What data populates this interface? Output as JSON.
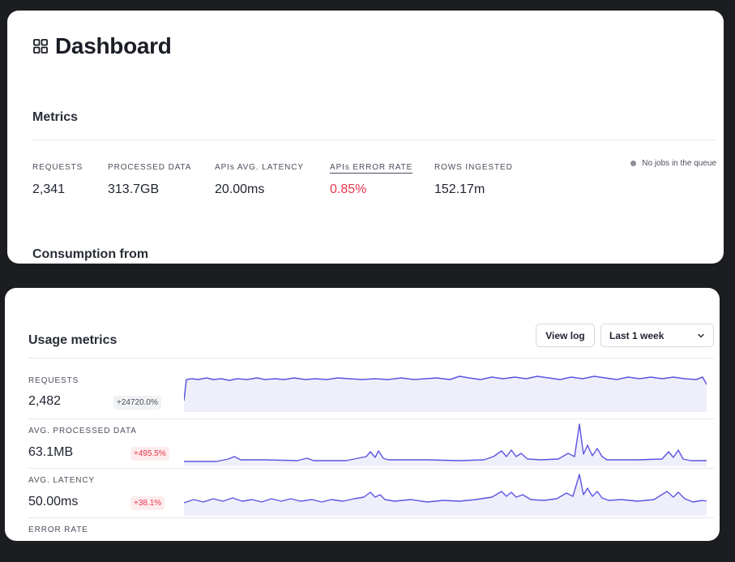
{
  "dashboard": {
    "title": "Dashboard",
    "icon": "grid-icon",
    "metrics_title": "Metrics",
    "metrics": [
      {
        "label": "REQUESTS",
        "value": "2,341"
      },
      {
        "label": "PROCESSED DATA",
        "value": "313.7GB"
      },
      {
        "label": "APIs AVG. LATENCY",
        "value": "20.00ms"
      },
      {
        "label": "APIs ERROR RATE",
        "value": "0.85%"
      },
      {
        "label": "ROWS INGESTED",
        "value": "152.17m"
      }
    ],
    "queue_status": "No jobs in the queue",
    "consumption_title": "Consumption from"
  },
  "usage": {
    "title": "Usage metrics",
    "view_log_label": "View log",
    "period_value": "Last 1 week",
    "rows": [
      {
        "label": "REQUESTS",
        "value": "2,482",
        "change": "+24720.0%"
      },
      {
        "label": "AVG. PROCESSED DATA",
        "value": "63.1MB",
        "change": "+495.5%"
      },
      {
        "label": "AVG. LATENCY",
        "value": "50.00ms",
        "change": "+38.1%"
      },
      {
        "label": "ERROR RATE",
        "value": "",
        "change": ""
      }
    ]
  },
  "colors": {
    "accent": "#5b55e0",
    "accent_fill": "#efeefb",
    "error": "#e8364b",
    "panel": "#ffffff",
    "background": "#1c1d20"
  }
}
